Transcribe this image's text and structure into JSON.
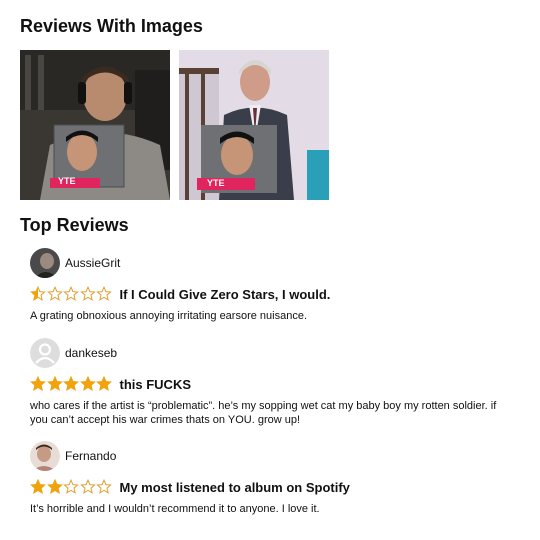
{
  "images_section": {
    "title": "Reviews With Images",
    "images": [
      {
        "subject": "man with headphones napping holding album cover",
        "album_label": "YTE"
      },
      {
        "subject": "man in suit seated holding album cover",
        "album_label": "YTE"
      }
    ]
  },
  "top_reviews_section": {
    "title": "Top Reviews",
    "reviews": [
      {
        "author": "AussieGrit",
        "avatar": "photo-avatar",
        "rating": 0.5,
        "rating_max": 5,
        "title": "If I Could Give Zero Stars, I would.",
        "body": "A grating obnoxious annoying irritating earsore nuisance."
      },
      {
        "author": "dankeseb",
        "avatar": "default-user-icon",
        "rating": 5,
        "rating_max": 5,
        "title": "this FUCKS",
        "body": "who cares if the artist is “problematic”. he’s my sopping wet cat my baby boy my rotten soldier. if you can’t accept his war crimes thats on YOU. grow up!"
      },
      {
        "author": "Fernando",
        "avatar": "photo-avatar",
        "rating": 2,
        "rating_max": 5,
        "title": "My most listened to album on Spotify",
        "body": "It’s horrible and I wouldn’t recommend it to anyone. I love it."
      }
    ]
  },
  "colors": {
    "star_fill": "#f0a30a",
    "star_empty_stroke": "#e0a030",
    "default_avatar_bg": "#dddddd"
  }
}
